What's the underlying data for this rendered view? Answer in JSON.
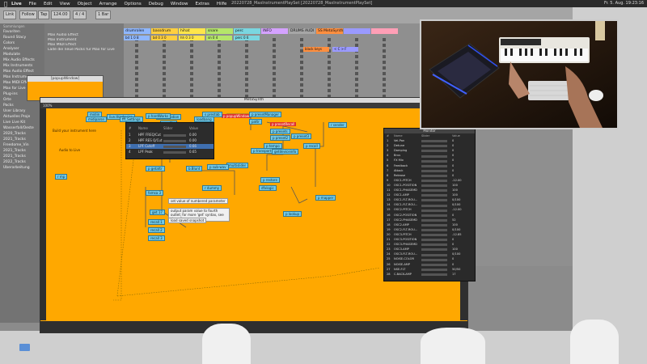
{
  "menubar": {
    "app": "Live",
    "items": [
      "File",
      "Edit",
      "View",
      "Object",
      "Arrange",
      "Options",
      "Debug",
      "Window",
      "Extras",
      "Hilfe"
    ],
    "title": "20220728_MaxInstrumentPlaySet [20220728_MaxInstrumentPlaySet]",
    "clock": "Fr. 5. Aug. 19:23:16"
  },
  "live": {
    "link": "Link",
    "follow": "Follow",
    "tap": "Tap",
    "tempo": "124.00",
    "sig": "4 / 4",
    "bars": "1 Bar",
    "browser_title": "Sammlungen",
    "browser_items": [
      "Favoriten",
      "Round Stacy",
      "Colors",
      "Analyser",
      "Modulate",
      "Mix Audio Effects",
      "Mix Instruments",
      "Max Audio Effect",
      "Max Instrument",
      "Max MIDI Effect",
      "Max for Live",
      "Plug-ins",
      "Orte",
      "Packs",
      "User Library",
      "Aktuelles Proje",
      "Live Live Kit",
      "Wasserfall/Oeste",
      "2020_Tracks",
      "2021_Tracks",
      "Freedome_Vin",
      "2021_Tracks",
      "2021_Tracks",
      "2022_Tracks",
      "Uberarbeitung"
    ],
    "side_list": [
      "Max Audio Effect",
      "Max Instrument",
      "Max MIDI Effect",
      "Lade die neue Packs fur Max for Live"
    ],
    "tracks": [
      {
        "name": "drumrolen",
        "color": "#8fb7ff"
      },
      {
        "name": "bassdrum",
        "color": "#ffcf3f"
      },
      {
        "name": "hihat",
        "color": "#ffe64a"
      },
      {
        "name": "snare",
        "color": "#b5e66a"
      },
      {
        "name": "perc",
        "color": "#7ad6e0"
      },
      {
        "name": "INFO",
        "color": "#d4a2ff"
      },
      {
        "name": "DRUMS AUDI",
        "color": "#a6a6a6"
      },
      {
        "name": "SS MetaSynth",
        "color": "#ff8f3f"
      },
      {
        "name": "",
        "color": "#9a9aff"
      },
      {
        "name": "",
        "color": "#ff9fb6"
      }
    ],
    "clips": [
      "bd 1 0 8",
      "bd 0 3 0",
      "hh 0 3 0",
      "sn 0 4",
      "perc 0 6",
      "black keys",
      "< C > F"
    ],
    "device_title": "MetaSynth",
    "status": "2 Clips"
  },
  "popup": {
    "title": "[popupWindow]"
  },
  "maxwin": {
    "title": "MetaSynth",
    "zoom": "100%",
    "hint": "Build your instrument here",
    "hint2": "Audio to Live",
    "objects": [
      "midiin",
      "midiparse",
      "live.thisdevice",
      "fff_Settings",
      "presentation",
      "p popupWindow",
      "p presetManager",
      "p presetRecall",
      "p hardWorks",
      "p trigger",
      "p nofile",
      "loadbang",
      "s prestab",
      "pattr",
      "p presets",
      "p preset2",
      "p preset3",
      "p recall",
      "p tempo",
      "p transport",
      "getdeviceinfo",
      "multislider",
      "p sub-wav",
      "b.Blunt",
      "r mp",
      "p getattr",
      "r dummy",
      "r sender",
      "p restore",
      "dfxlogic",
      "p mapper",
      "p lookup"
    ],
    "red_objects": [
      "p popupWindow",
      "p presetRecall"
    ],
    "comments": [
      "set value of numbered parameter",
      "output param value to fourth outlet; for more 'get' syntax, see the ref",
      "load saved snapshot"
    ],
    "messages": [
      "fxmsa 3",
      "get 17",
      "recall 1",
      "recall 2",
      "recall 3"
    ]
  },
  "ptable": {
    "headers": [
      "#",
      "Name",
      "Slider",
      "Value"
    ],
    "rows": [
      {
        "n": "1",
        "name": "HPF FREQ/Cut",
        "val": "0.00"
      },
      {
        "n": "2",
        "name": "HPF RES Q/Cut",
        "val": "0.00"
      },
      {
        "n": "3",
        "name": "LPF Cutoff",
        "val": "0.66"
      },
      {
        "n": "4",
        "name": "LPF Peak",
        "val": "0.65"
      }
    ]
  },
  "monitor": {
    "title": "Monitor",
    "headers": [
      "#",
      "Name",
      "Slider",
      "Value"
    ],
    "rows": [
      {
        "n": "1",
        "name": "Vel-Pan",
        "val": "0"
      },
      {
        "n": "2",
        "name": "Detune",
        "val": "0"
      },
      {
        "n": "3",
        "name": "Damping",
        "val": "0"
      },
      {
        "n": "4",
        "name": "Brus",
        "val": "0"
      },
      {
        "n": "5",
        "name": "FX Mix",
        "val": "0"
      },
      {
        "n": "6",
        "name": "Feedback",
        "val": "0"
      },
      {
        "n": "7",
        "name": "Attack",
        "val": "0"
      },
      {
        "n": "8",
        "name": "Release",
        "val": "0"
      },
      {
        "n": "9",
        "name": "OSC1-PITCH",
        "val": "-12.00"
      },
      {
        "n": "10",
        "name": "OSC1-POSITION",
        "val": "100"
      },
      {
        "n": "11",
        "name": "OSC1-PHASEMD",
        "val": "100"
      },
      {
        "n": "12",
        "name": "OSC1-AMP",
        "val": "100"
      },
      {
        "n": "13",
        "name": "OSC1-FLT-ROU...",
        "val": "0/100"
      },
      {
        "n": "14",
        "name": "OSC1-FLT-ROU...",
        "val": "0/100"
      },
      {
        "n": "15",
        "name": "OSC2-PITCH",
        "val": "-12.00"
      },
      {
        "n": "16",
        "name": "OSC2-POSITION",
        "val": "0"
      },
      {
        "n": "17",
        "name": "OSC2-PHASEMD",
        "val": "52"
      },
      {
        "n": "18",
        "name": "OSC2-AMP",
        "val": "100"
      },
      {
        "n": "19",
        "name": "OSC2-FLT-ROU...",
        "val": "0/100"
      },
      {
        "n": "20",
        "name": "OSC3-PITCH",
        "val": "-12.85"
      },
      {
        "n": "21",
        "name": "OSC3-POSITION",
        "val": "0"
      },
      {
        "n": "22",
        "name": "OSC3-PHASEMD",
        "val": "0"
      },
      {
        "n": "23",
        "name": "OSC3-AMP",
        "val": "100"
      },
      {
        "n": "24",
        "name": "OSC3-FLT-ROU...",
        "val": "0/100"
      },
      {
        "n": "25",
        "name": "NOISE-COLOR",
        "val": "0"
      },
      {
        "n": "26",
        "name": "NOISE-AMP",
        "val": "0"
      },
      {
        "n": "27",
        "name": "NSE-FLT",
        "val": "50/50"
      },
      {
        "n": "28",
        "name": "C-BACK-AMP",
        "val": "17"
      }
    ]
  },
  "desktop": {
    "folder_label": ""
  }
}
